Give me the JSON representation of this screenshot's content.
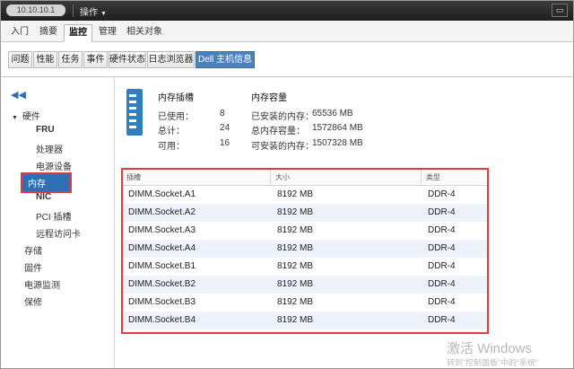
{
  "titlebar": {
    "host": "10.10.10.1",
    "actions_label": "操作",
    "window_control": "▭"
  },
  "main_tabs": [
    {
      "label": "入门"
    },
    {
      "label": "摘要"
    },
    {
      "label": "监控"
    },
    {
      "label": "管理"
    },
    {
      "label": "相关对象"
    }
  ],
  "sub_tabs": [
    {
      "label": "问题"
    },
    {
      "label": "性能"
    },
    {
      "label": "任务"
    },
    {
      "label": "事件"
    },
    {
      "label": "硬件状态"
    },
    {
      "label": "日志浏览器"
    },
    {
      "label": "Dell 主机信息"
    }
  ],
  "sidebar": {
    "collapse_icon": "◀◀",
    "hardware_label": "硬件",
    "items": [
      {
        "label": "FRU"
      },
      {
        "label": "处理器"
      },
      {
        "label": "电源设备"
      },
      {
        "label": "内存"
      },
      {
        "label": "NIC"
      },
      {
        "label": "PCI 插槽"
      },
      {
        "label": "远程访问卡"
      }
    ],
    "top_items": [
      {
        "label": "存储"
      },
      {
        "label": "固件"
      },
      {
        "label": "电源监测"
      },
      {
        "label": "保修"
      }
    ]
  },
  "memory_slots": {
    "title": "内存插槽",
    "used_label": "已使用：",
    "used_value": "8",
    "total_label": "总计：",
    "total_value": "24",
    "available_label": "可用：",
    "available_value": "16"
  },
  "memory_capacity": {
    "title": "内存容量",
    "installed_label": "已安装的内存：",
    "installed_value": "65536 MB",
    "total_label": "总内存容量：",
    "total_value": "1572864 MB",
    "installable_label": "可安装的内存：",
    "installable_value": "1507328 MB"
  },
  "table": {
    "columns": [
      "插槽",
      "大小",
      "类型"
    ],
    "rows": [
      {
        "slot": "DIMM.Socket.A1",
        "size": "8192 MB",
        "type": "DDR-4"
      },
      {
        "slot": "DIMM.Socket.A2",
        "size": "8192 MB",
        "type": "DDR-4"
      },
      {
        "slot": "DIMM.Socket.A3",
        "size": "8192 MB",
        "type": "DDR-4"
      },
      {
        "slot": "DIMM.Socket.A4",
        "size": "8192 MB",
        "type": "DDR-4"
      },
      {
        "slot": "DIMM.Socket.B1",
        "size": "8192 MB",
        "type": "DDR-4"
      },
      {
        "slot": "DIMM.Socket.B2",
        "size": "8192 MB",
        "type": "DDR-4"
      },
      {
        "slot": "DIMM.Socket.B3",
        "size": "8192 MB",
        "type": "DDR-4"
      },
      {
        "slot": "DIMM.Socket.B4",
        "size": "8192 MB",
        "type": "DDR-4"
      }
    ]
  },
  "watermark": {
    "line1": "激活 Windows",
    "line2": "转到“控制面板”中的“系统”"
  },
  "colors": {
    "accent": "#2f6fb3",
    "highlight_border": "#e23b3b",
    "active_subtab": "#4a82c0"
  }
}
